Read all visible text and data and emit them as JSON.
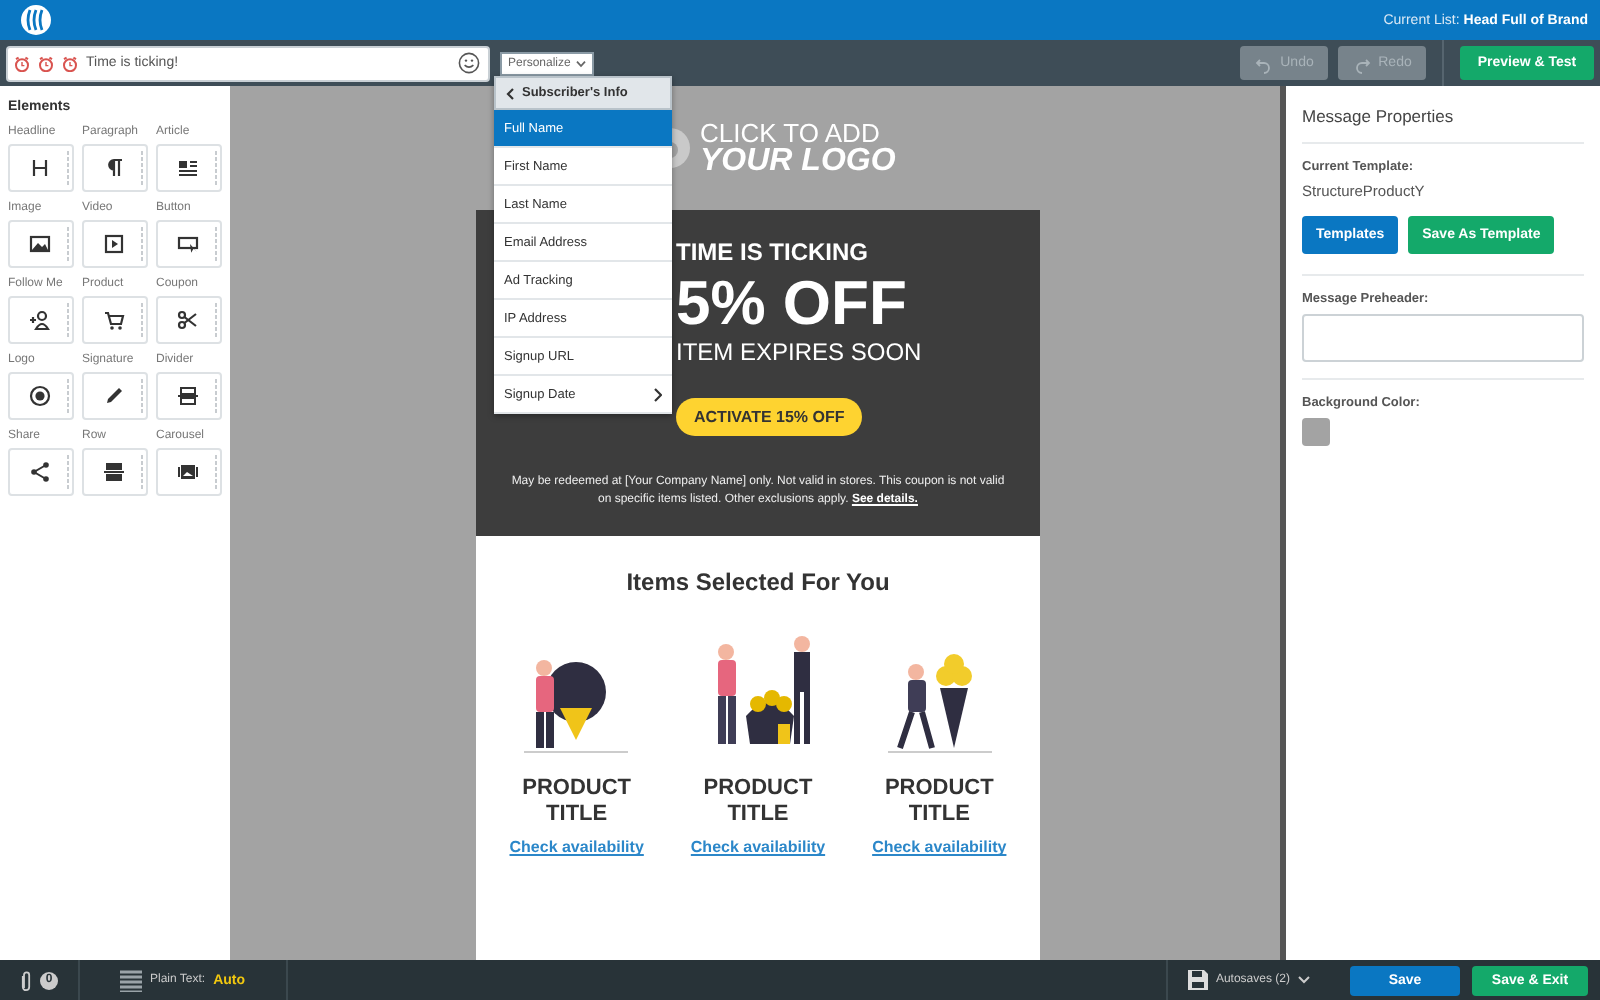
{
  "top_bar": {
    "current_list_label": "Current List:",
    "current_list": "Head Full of Brand"
  },
  "toolbar": {
    "subject": "Time is ticking!",
    "personalize": "Personalize",
    "undo": {
      "label": "Undo",
      "disabled": true
    },
    "redo": {
      "label": "Redo",
      "disabled": true
    },
    "preview": "Preview & Test"
  },
  "personalize_menu": {
    "header": "Subscriber's Info",
    "items": [
      {
        "label": "Full Name",
        "selected": true,
        "submenu": false
      },
      {
        "label": "First Name",
        "selected": false,
        "submenu": false
      },
      {
        "label": "Last Name",
        "selected": false,
        "submenu": false
      },
      {
        "label": "Email Address",
        "selected": false,
        "submenu": false
      },
      {
        "label": "Ad Tracking",
        "selected": false,
        "submenu": false
      },
      {
        "label": "IP Address",
        "selected": false,
        "submenu": false
      },
      {
        "label": "Signup URL",
        "selected": false,
        "submenu": false
      },
      {
        "label": "Signup Date",
        "selected": false,
        "submenu": true
      }
    ]
  },
  "elements_panel": {
    "title": "Elements",
    "items": [
      {
        "label": "Headline"
      },
      {
        "label": "Paragraph"
      },
      {
        "label": "Article"
      },
      {
        "label": "Image"
      },
      {
        "label": "Video"
      },
      {
        "label": "Button"
      },
      {
        "label": "Follow Me"
      },
      {
        "label": "Product"
      },
      {
        "label": "Coupon"
      },
      {
        "label": "Logo"
      },
      {
        "label": "Signature"
      },
      {
        "label": "Divider"
      },
      {
        "label": "Share"
      },
      {
        "label": "Row"
      },
      {
        "label": "Carousel"
      }
    ]
  },
  "email": {
    "logo": {
      "line_1": "CLICK TO ADD",
      "line_2": "YOUR LOGO"
    },
    "banner": {
      "eyebrow": "TIME IS TICKING",
      "headline": "5% OFF",
      "subline": "ITEM EXPIRES SOON",
      "button": "ACTIVATE 15% OFF",
      "disclaimer": "May be redeemed at [Your Company Name] only. Not valid in stores. This coupon is not valid on specific items listed. Other exclusions apply.",
      "disclaimer_link": "See details."
    },
    "products_title": "Items Selected For You",
    "products": [
      {
        "title": "PRODUCT TITLE",
        "link": "Check availability"
      },
      {
        "title": "PRODUCT TITLE",
        "link": "Check availability"
      },
      {
        "title": "PRODUCT TITLE",
        "link": "Check availability"
      }
    ]
  },
  "properties": {
    "title": "Message Properties",
    "template_label": "Current Template:",
    "template": "StructureProductY",
    "templates_button": "Templates",
    "save_template_button": "Save As Template",
    "preheader_label": "Message Preheader:",
    "background_label": "Background Color:"
  },
  "footer": {
    "attachments": "0",
    "plain_text_label": "Plain Text:",
    "plain_text_value": "Auto",
    "autosaves": "Autosaves (2)",
    "save": "Save",
    "save_exit": "Save & Exit"
  }
}
